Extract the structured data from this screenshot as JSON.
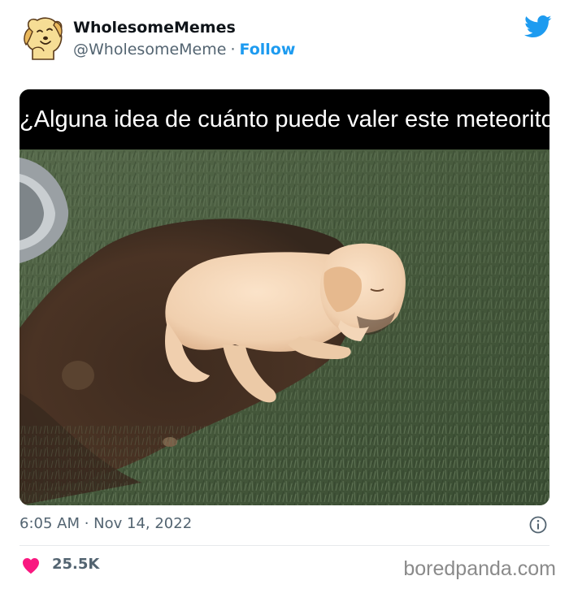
{
  "tweet": {
    "display_name": "WholesomeMemes",
    "handle": "@WholesomeMeme",
    "separator": "·",
    "follow_label": "Follow",
    "caption": "¿Alguna idea de cuánto puede valer este meteorito?",
    "timestamp": "6:05 AM · Nov 14, 2022",
    "likes": "25.5K"
  },
  "icons": {
    "avatar": "shiba-dog-avatar",
    "brand": "twitter-bird-icon",
    "info": "info-icon",
    "like": "heart-icon"
  },
  "colors": {
    "accent": "#1d9bf0",
    "twitter_logo": "#1d9bf0",
    "heart": "#f91880",
    "secondary_text": "#536471",
    "caption_bg": "#000000"
  },
  "watermark": "boredpanda.com"
}
